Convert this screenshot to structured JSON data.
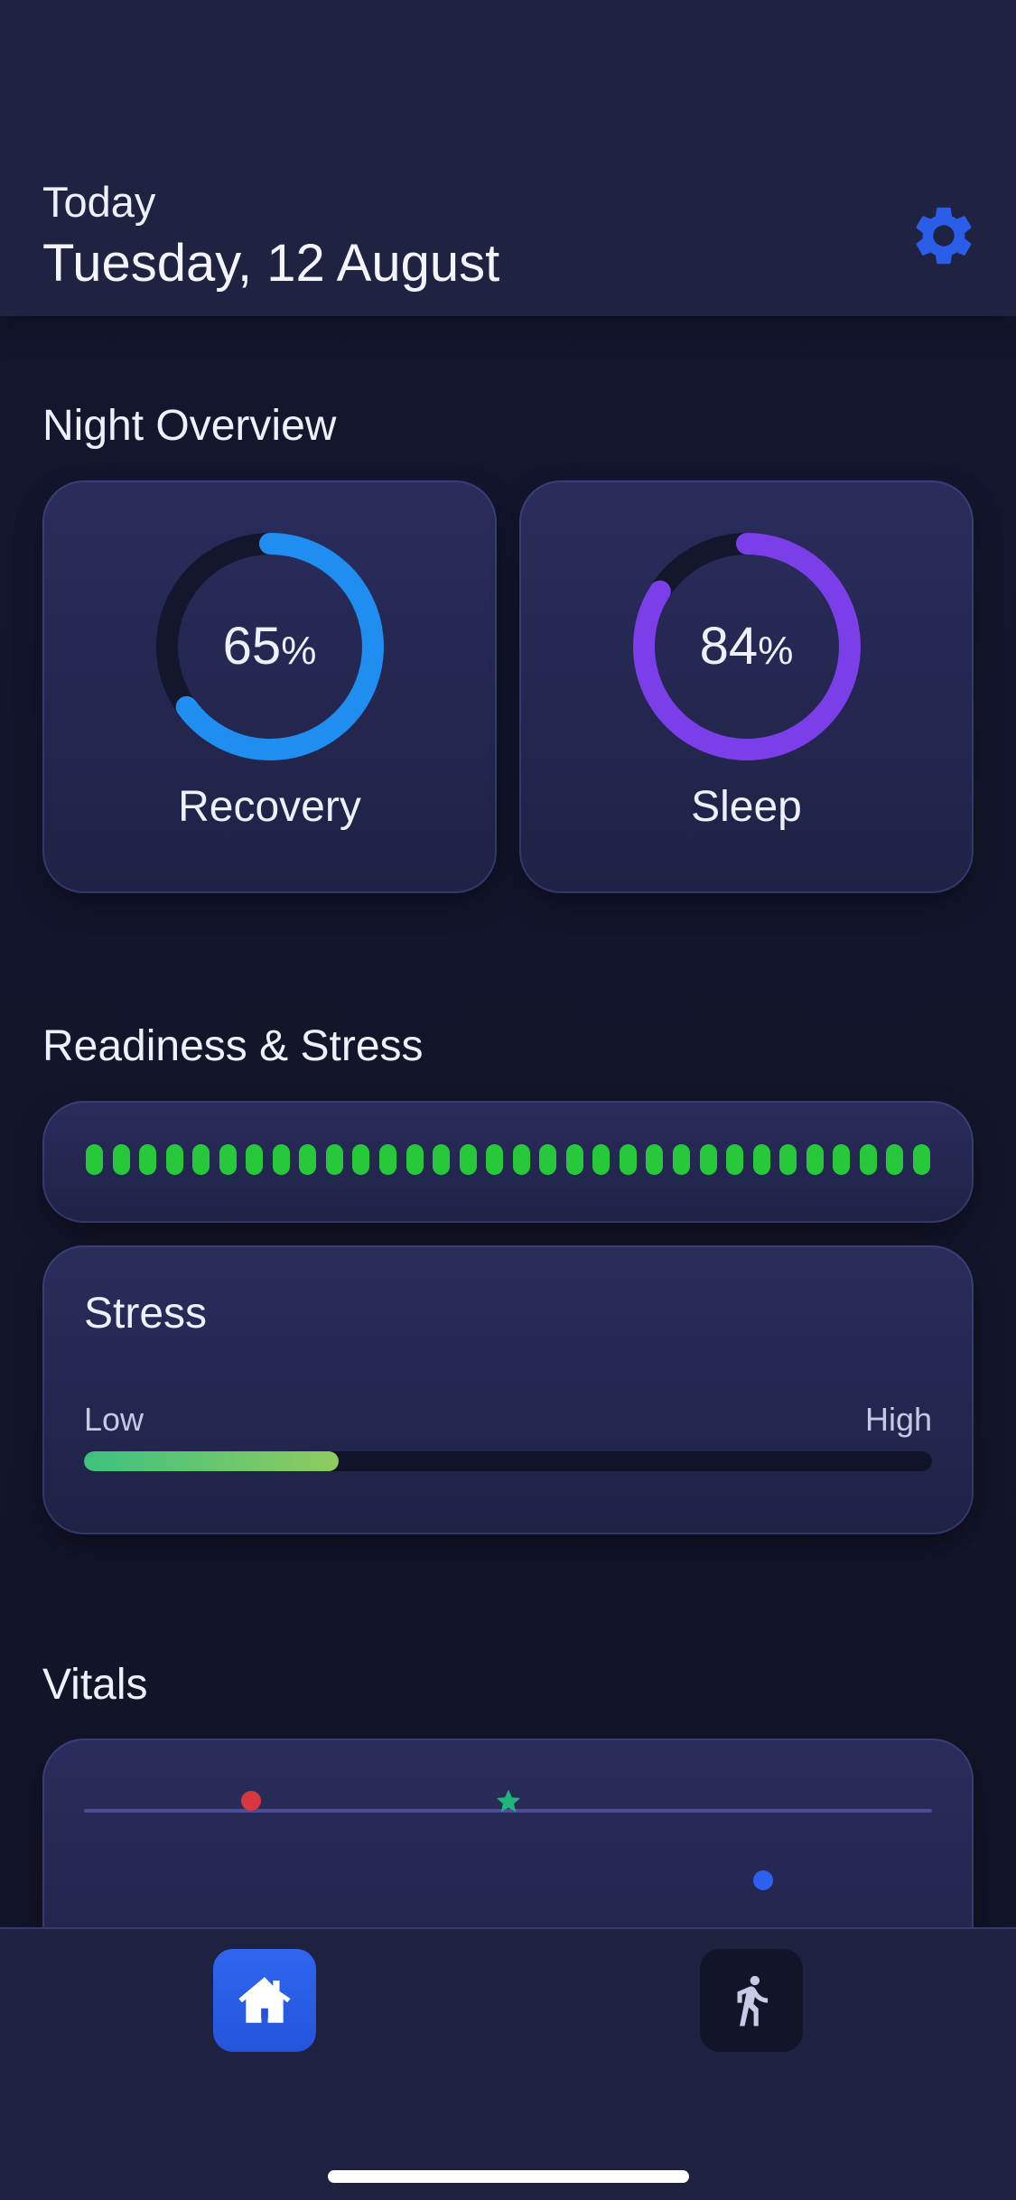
{
  "header": {
    "subtitle": "Today",
    "date": "Tuesday, 12 August"
  },
  "night_overview": {
    "title": "Night Overview",
    "recovery": {
      "value": "65",
      "unit": "%",
      "label": "Recovery",
      "fraction": 0.65,
      "color": "#1f8ef0"
    },
    "sleep": {
      "value": "84",
      "unit": "%",
      "label": "Sleep",
      "fraction": 0.84,
      "color": "#7b3fe9"
    }
  },
  "readiness": {
    "title": "Readiness & Stress",
    "segments_total": 32,
    "segment_color": "#27c93a"
  },
  "stress": {
    "title": "Stress",
    "low_label": "Low",
    "high_label": "High",
    "level": 0.3
  },
  "vitals": {
    "title": "Vitals",
    "markers": [
      {
        "shape": "dot",
        "color": "#d9373f"
      },
      {
        "shape": "star",
        "color": "#1fb57a"
      },
      {
        "shape": "dot",
        "color": "#2d5ff0"
      }
    ]
  },
  "tabbar": {
    "items": [
      {
        "icon": "home-icon",
        "active": true
      },
      {
        "icon": "running-icon",
        "active": false
      }
    ]
  }
}
